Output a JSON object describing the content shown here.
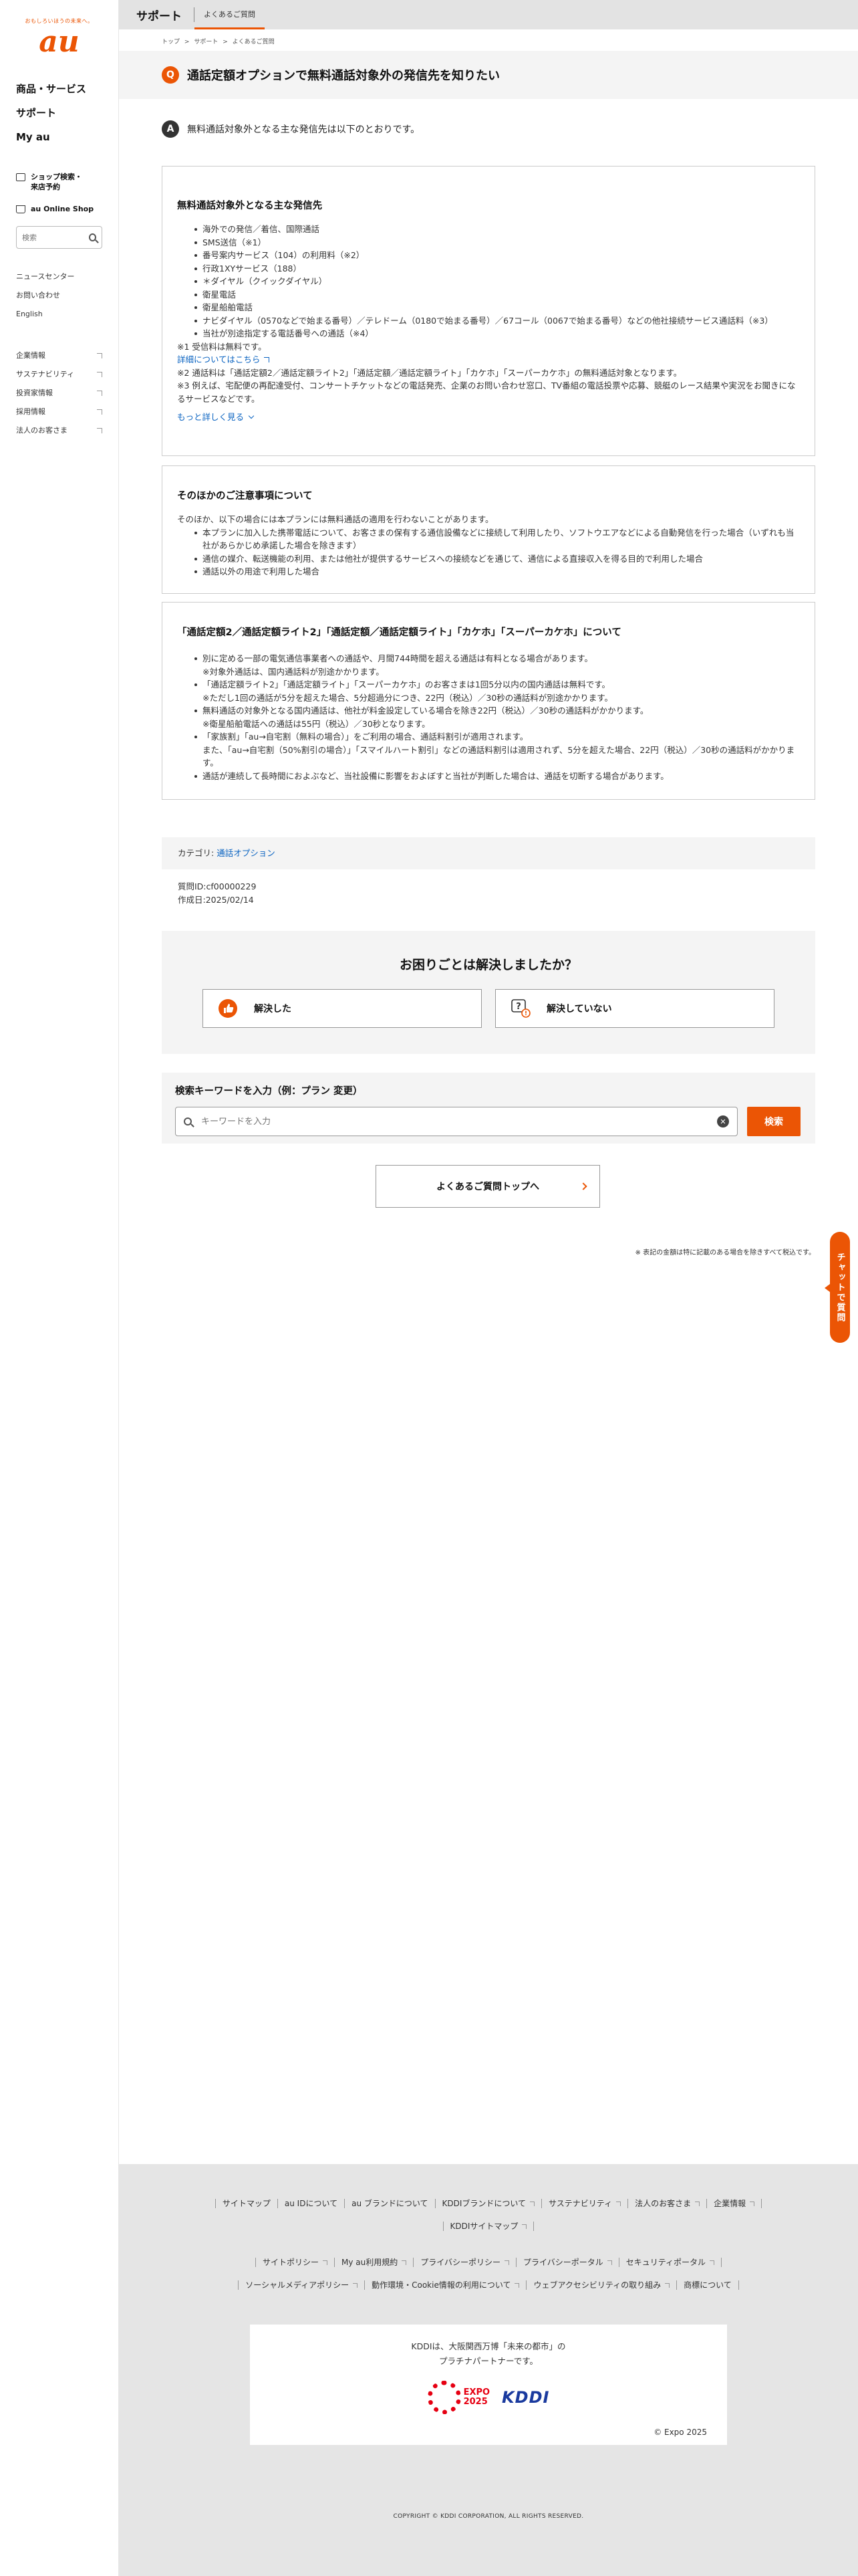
{
  "brand": {
    "tagline": "おもしろいほうの未来へ。",
    "logo": "au"
  },
  "sidebar": {
    "main_nav": [
      "商品・サービス",
      "サポート",
      "My au"
    ],
    "shop_search": "ショップ検索・\n来店予約",
    "online_shop": "au Online Shop",
    "search_placeholder": "検索",
    "links": [
      "ニュースセンター",
      "お問い合わせ",
      "English"
    ],
    "corporate": [
      "企業情報",
      "サステナビリティ",
      "投資家情報",
      "採用情報",
      "法人のお客さま"
    ]
  },
  "header": {
    "title": "サポート",
    "tab": "よくあるご質問"
  },
  "breadcrumb": [
    "トップ",
    ">",
    "サポート",
    ">",
    "よくあるご質問"
  ],
  "question": {
    "badge": "Q",
    "title": "通話定額オプションで無料通話対象外の発信先を知りたい"
  },
  "answer": {
    "badge": "A",
    "text": "無料通話対象外となる主な発信先は以下のとおりです。"
  },
  "card1": {
    "heading": "無料通話対象外となる主な発信先",
    "items": [
      "海外での発信／着信、国際通話",
      "SMS送信（※1）",
      "番号案内サービス（104）の利用料（※2）",
      "行政1XYサービス（188）",
      "＊ダイヤル（クイックダイヤル）",
      "衛星電話",
      "衛星船舶電話",
      "ナビダイヤル（0570などで始まる番号）／テレドーム（0180で始まる番号）／67コール（0067で始まる番号）などの他社接続サービス通話料（※3）",
      "当社が別途指定する電話番号への通話（※4）"
    ],
    "note1": "※1 受信料は無料です。",
    "link": "詳細についてはこちら",
    "note2": "※2 通話料は「通話定額2／通話定額ライト2」「通話定額／通話定額ライト」「カケホ」「スーパーカケホ」の無料通話対象となります。",
    "note3": "※3 例えば、宅配便の再配達受付、コンサートチケットなどの電話発売、企業のお問い合わせ窓口、TV番組の電話投票や応募、競艇のレース結果や実況をお聞きになるサービスなどです。",
    "more": "もっと詳しく見る"
  },
  "card2": {
    "heading": "そのほかのご注意事項について",
    "intro": "そのほか、以下の場合には本プランには無料通話の適用を行わないことがあります。",
    "items": [
      "本プランに加入した携帯電話について、お客さまの保有する通信設備などに接続して利用したり、ソフトウエアなどによる自動発信を行った場合（いずれも当社があらかじめ承諾した場合を除きます）",
      "通信の媒介、転送機能の利用、または他社が提供するサービスへの接続などを通じて、通信による直接収入を得る目的で利用した場合",
      "通話以外の用途で利用した場合"
    ]
  },
  "card3": {
    "heading": "「通話定額2／通話定額ライト2」「通話定額／通話定額ライト」「カケホ」「スーパーカケホ」について",
    "items": [
      "別に定める一部の電気通信事業者への通話や、月間744時間を超える通話は有料となる場合があります。\n※対象外通話は、国内通話料が別途かかります。",
      "「通話定額ライト2」「通話定額ライト」「スーパーカケホ」のお客さまは1回5分以内の国内通話は無料です。\n※ただし1回の通話が5分を超えた場合、5分超過分につき、22円（税込）／30秒の通話料が別途かかります。",
      "無料通話の対象外となる国内通話は、他社が料金設定している場合を除き22円（税込）／30秒の通話料がかかります。\n※衛星船舶電話への通話は55円（税込）／30秒となります。",
      "「家族割」「au→自宅割（無料の場合）」をご利用の場合、通話料割引が適用されます。\nまた、「au→自宅割（50%割引の場合）」「スマイルハート割引」などの通話料割引は適用されず、5分を超えた場合、22円（税込）／30秒の通話料がかかります。",
      "通話が連続して長時間におよぶなど、当社設備に影響をおよぼすと当社が判断した場合は、通話を切断する場合があります。"
    ]
  },
  "meta": {
    "category_label": "カテゴリ: ",
    "category_link": "通話オプション",
    "question_id": "質問ID:cf00000229",
    "created": "作成日:2025/02/14"
  },
  "resolve": {
    "title": "お困りごとは解決しましたか？",
    "yes": "解決した",
    "no": "解決していない"
  },
  "search": {
    "label": "検索キーワードを入力（例：プラン 変更）",
    "placeholder": "キーワードを入力",
    "button": "検索"
  },
  "faq_top": "よくあるご質問トップへ",
  "fineprint": "※ 表記の金額は特に記載のある場合を除きすべて税込です。",
  "chat": "チャットで質問",
  "footer": {
    "row1": [
      "サイトマップ",
      "au IDについて",
      "au ブランドについて",
      "KDDIブランドについて",
      "サステナビリティ",
      "法人のお客さま",
      "企業情報"
    ],
    "row1b": [
      "KDDIサイトマップ"
    ],
    "row2": [
      "サイトポリシー",
      "My au利用規約",
      "プライバシーポリシー",
      "プライバシーポータル",
      "セキュリティポータル"
    ],
    "row3": [
      "ソーシャルメディアポリシー",
      "動作環境・Cookie情報の利用について",
      "ウェブアクセシビリティの取り組み",
      "商標について"
    ],
    "expo_msg1": "KDDIは、大阪関西万博「未来の都市」の",
    "expo_msg2": "プラチナパートナーです。",
    "expo_word": "EXPO\n2025",
    "kddi": "KDDI",
    "expo_copy": "© Expo 2025",
    "copyright": "COPYRIGHT © KDDI CORPORATION, ALL RIGHTS RESERVED."
  },
  "colors": {
    "accent": "#eb5505",
    "link": "#0a63c1",
    "panel": "#f4f4f4"
  }
}
